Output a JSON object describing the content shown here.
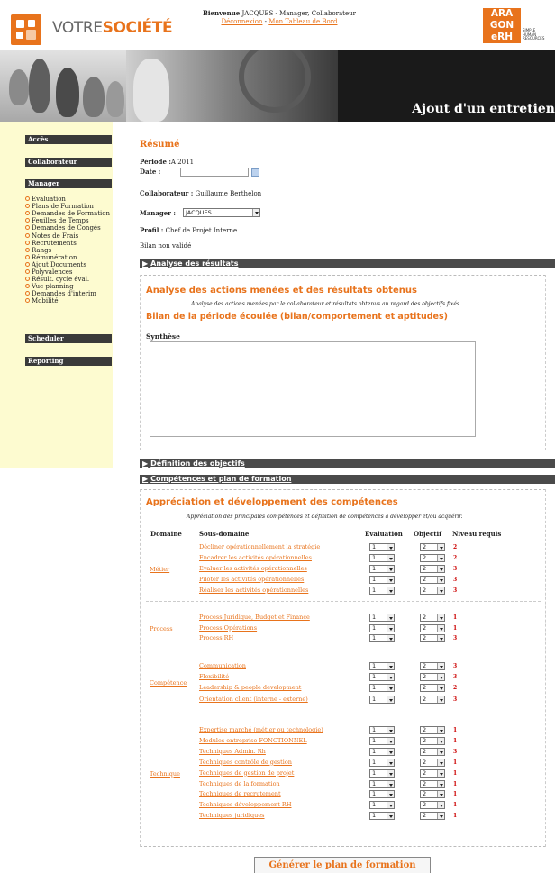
{
  "brand": {
    "logo_plain": "VOTRE",
    "logo_bold": "SOCIÉTÉ",
    "partner": [
      "ARA",
      "GON",
      "eRH"
    ],
    "partner_tagline": [
      "SIMPLE",
      "HUMAN",
      "RESOURCES"
    ],
    "accent": "#e8731c"
  },
  "header": {
    "welcome_bold": "Bienvenue",
    "welcome_rest": " JACQUES - Manager, Collaborateur",
    "logout": "Déconnexion",
    "dashboard": "Mon Tableau de Bord",
    "sep": " - "
  },
  "banner": {
    "title": "Ajout d'un entretien"
  },
  "sidebar": {
    "sections": [
      "Accès",
      "Collaborateur",
      "Manager",
      "Scheduler",
      "Reporting"
    ],
    "manager_items": [
      "Evaluation",
      "Plans de Formation",
      "Demandes de Formation",
      "Feuilles de Temps",
      "Demandes de Congés",
      "Notes de Frais",
      "Recrutements",
      "Rangs",
      "Rémunération",
      "Ajout Documents",
      "Polyvalences",
      "Résult. cycle éval.",
      "Vue planning",
      "Demandes d'interim",
      "Mobilité"
    ]
  },
  "summary": {
    "title": "Résumé",
    "periode_label": "Période :",
    "periode_value": "A 2011",
    "date_label": "Date :",
    "collab_label": "Collaborateur :",
    "collab_value": "Guillaume Berthelon",
    "manager_label": "Manager :",
    "manager_value": "JACQUES",
    "profil_label": "Profil :",
    "profil_value": "Chef de Projet Interne",
    "status": "Bilan non validé"
  },
  "sections": {
    "analyse": "Analyse des résultats",
    "objectifs": "Définition des objectifs",
    "competences": "Compétences et plan de formation"
  },
  "analyse": {
    "h1": "Analyse des actions menées et des résultats obtenus",
    "note": "Analyse des actions menées par le collaborateur et résultats obtenus au regard des objectifs fixés.",
    "h2": "Bilan de la période écoulée (bilan/comportement et aptitudes)",
    "synthese": "Synthèse"
  },
  "competences": {
    "h1": "Appréciation et développement des compétences",
    "note": "Appréciation des principales compétences et définition de compétences à développer et/ou acquérir.",
    "headers": {
      "domaine": "Domaine",
      "sous_domaine": "Sous-domaine",
      "evaluation": "Evaluation",
      "objectif": "Objectif",
      "niveau": "Niveau requis"
    },
    "groups": [
      {
        "domain": "Métier",
        "rows": [
          {
            "name": "Décliner opérationnellement la stratégie",
            "eval": "1",
            "obj": "2",
            "req": "2"
          },
          {
            "name": "Encadrer les activités opérationnelles",
            "eval": "1",
            "obj": "2",
            "req": "2"
          },
          {
            "name": "Evaluer les activités opérationnelles",
            "eval": "1",
            "obj": "2",
            "req": "3"
          },
          {
            "name": "Piloter les activités opérationnelles",
            "eval": "1",
            "obj": "2",
            "req": "3"
          },
          {
            "name": "Réaliser les activités opérationnelles",
            "eval": "1",
            "obj": "2",
            "req": "3"
          }
        ]
      },
      {
        "domain": "Process",
        "rows": [
          {
            "name": "Process Juridique, Budget et Finance",
            "eval": "1",
            "obj": "2",
            "req": "1"
          },
          {
            "name": "Process Opérations",
            "eval": "1",
            "obj": "2",
            "req": "1"
          },
          {
            "name": "Process RH",
            "eval": "1",
            "obj": "2",
            "req": "3"
          }
        ]
      },
      {
        "domain": "Compétence",
        "rows": [
          {
            "name": "Communication",
            "eval": "1",
            "obj": "2",
            "req": "3"
          },
          {
            "name": "Flexibilité",
            "eval": "1",
            "obj": "2",
            "req": "3"
          },
          {
            "name": "Leadership & people development",
            "eval": "1",
            "obj": "2",
            "req": "2"
          },
          {
            "name": "Orientation client (interne - externe)",
            "eval": "1",
            "obj": "2",
            "req": "3"
          }
        ]
      },
      {
        "domain": "Technique",
        "rows": [
          {
            "name": "Expertise marché (métier ou technologie)",
            "eval": "1",
            "obj": "2",
            "req": "1"
          },
          {
            "name": "Modules entreprise FONCTIONNEL",
            "eval": "1",
            "obj": "2",
            "req": "1"
          },
          {
            "name": "Techniques Admin. Rh",
            "eval": "1",
            "obj": "2",
            "req": "3"
          },
          {
            "name": "Techniques contrôle de gestion",
            "eval": "1",
            "obj": "2",
            "req": "1"
          },
          {
            "name": "Techniques de gestion de projet",
            "eval": "1",
            "obj": "2",
            "req": "1"
          },
          {
            "name": "Techniques de la formation",
            "eval": "1",
            "obj": "2",
            "req": "1"
          },
          {
            "name": "Techniques de recrutement",
            "eval": "1",
            "obj": "2",
            "req": "1"
          },
          {
            "name": "Techniques développement RH",
            "eval": "1",
            "obj": "2",
            "req": "1"
          },
          {
            "name": "Techniques juridiques",
            "eval": "1",
            "obj": "2",
            "req": "1"
          }
        ]
      }
    ]
  },
  "generate_button": "Générer le plan de formation"
}
